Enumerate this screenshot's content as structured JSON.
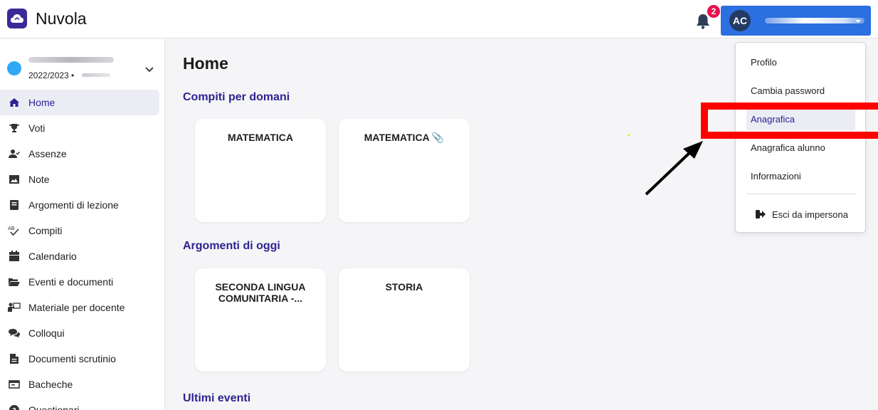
{
  "app": {
    "name": "Nuvola",
    "accent": "#2d2290",
    "primary_button": "#2b6fe0",
    "logo_icon": "cloud-icon"
  },
  "header": {
    "notifications_count": "2",
    "user_initials": "AC"
  },
  "sidebar": {
    "school_year": "2022/2023 •",
    "items": [
      {
        "label": "Home",
        "icon": "home-icon",
        "active": true
      },
      {
        "label": "Voti",
        "icon": "trophy-icon"
      },
      {
        "label": "Assenze",
        "icon": "user-check-icon"
      },
      {
        "label": "Note",
        "icon": "image-note-icon"
      },
      {
        "label": "Argomenti di lezione",
        "icon": "book-icon"
      },
      {
        "label": "Compiti",
        "icon": "spellcheck-icon"
      },
      {
        "label": "Calendario",
        "icon": "calendar-icon"
      },
      {
        "label": "Eventi e documenti",
        "icon": "folder-open-icon"
      },
      {
        "label": "Materiale per docente",
        "icon": "teacher-icon"
      },
      {
        "label": "Colloqui",
        "icon": "comments-icon"
      },
      {
        "label": "Documenti scrutinio",
        "icon": "file-icon"
      },
      {
        "label": "Bacheche",
        "icon": "board-icon"
      },
      {
        "label": "Questionari",
        "icon": "question-circle-icon"
      }
    ]
  },
  "main": {
    "title": "Home",
    "sections": [
      {
        "title": "Compiti per domani",
        "cards": [
          {
            "label": "MATEMATICA"
          },
          {
            "label": "MATEMATICA",
            "attachment": true
          }
        ]
      },
      {
        "title": "Argomenti di oggi",
        "cards": [
          {
            "label": "SECONDA LINGUA COMUNITARIA -..."
          },
          {
            "label": "STORIA"
          }
        ]
      },
      {
        "title": "Ultimi eventi"
      }
    ]
  },
  "user_menu": {
    "items": [
      "Profilo",
      "Cambia password",
      "Anagrafica",
      "Anagrafica alunno",
      "Informazioni"
    ],
    "highlighted": "Anagrafica",
    "exit_label": "Esci da impersona"
  }
}
